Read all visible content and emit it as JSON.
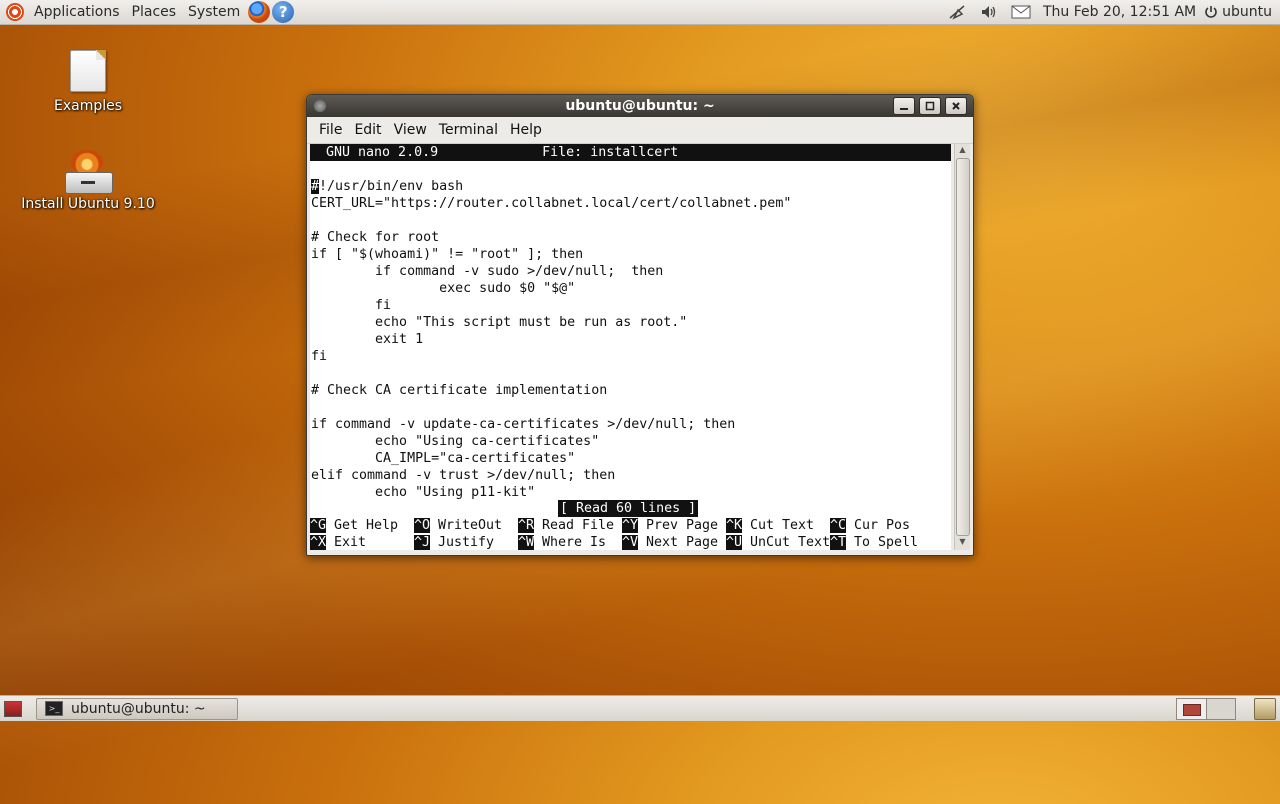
{
  "top_panel": {
    "menus": [
      "Applications",
      "Places",
      "System"
    ],
    "clock": "Thu Feb 20, 12:51 AM",
    "user": "ubuntu",
    "tray_icons": [
      "network-icon",
      "volume-icon",
      "mail-icon"
    ]
  },
  "desktop": {
    "icons": [
      {
        "label": "Examples"
      },
      {
        "label": "Install Ubuntu 9.10"
      }
    ]
  },
  "window": {
    "title": "ubuntu@ubuntu: ~",
    "menu": [
      "File",
      "Edit",
      "View",
      "Terminal",
      "Help"
    ]
  },
  "nano": {
    "header": "  GNU nano 2.0.9             File: installcert",
    "cursor_char": "#",
    "lines": [
      "",
      "!/usr/bin/env bash",
      "CERT_URL=\"https://router.collabnet.local/cert/collabnet.pem\"",
      "",
      "# Check for root",
      "if [ \"$(whoami)\" != \"root\" ]; then",
      "        if command -v sudo >/dev/null;  then",
      "                exec sudo $0 \"$@\"",
      "        fi",
      "        echo \"This script must be run as root.\"",
      "        exit 1",
      "fi",
      "",
      "# Check CA certificate implementation",
      "",
      "if command -v update-ca-certificates >/dev/null; then",
      "        echo \"Using ca-certificates\"",
      "        CA_IMPL=\"ca-certificates\"",
      "elif command -v trust >/dev/null; then",
      "        echo \"Using p11-kit\""
    ],
    "status": "[ Read 60 lines ]",
    "shortcuts_row1": [
      {
        "key": "^G",
        "label": "Get Help"
      },
      {
        "key": "^O",
        "label": "WriteOut"
      },
      {
        "key": "^R",
        "label": "Read File"
      },
      {
        "key": "^Y",
        "label": "Prev Page"
      },
      {
        "key": "^K",
        "label": "Cut Text"
      },
      {
        "key": "^C",
        "label": "Cur Pos"
      }
    ],
    "shortcuts_row2": [
      {
        "key": "^X",
        "label": "Exit"
      },
      {
        "key": "^J",
        "label": "Justify"
      },
      {
        "key": "^W",
        "label": "Where Is"
      },
      {
        "key": "^V",
        "label": "Next Page"
      },
      {
        "key": "^U",
        "label": "UnCut Text"
      },
      {
        "key": "^T",
        "label": "To Spell"
      }
    ]
  },
  "taskbar": {
    "task_label": "ubuntu@ubuntu: ~"
  }
}
